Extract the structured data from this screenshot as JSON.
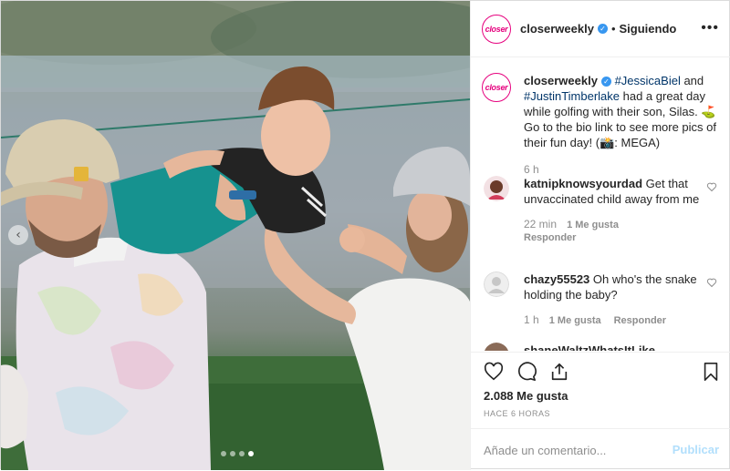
{
  "post": {
    "username": "closerweekly",
    "avatar_text": "closer",
    "verified_mark": "✓",
    "separator": "•",
    "follow_status": "Siguiendo",
    "more_icon": "•••"
  },
  "caption": {
    "username": "closerweekly",
    "tag1": "#JessicaBiel",
    "text1": " and ",
    "tag2": "#JustinTimberlake",
    "text2": " had a great day while golfing with their son, Silas. ⛳ Go to the bio link to see more pics of their fun day! (📸: MEGA)",
    "time": "6 h"
  },
  "comments": [
    {
      "username": "katnipknowsyourdad",
      "text": " Get that unvaccinated child away from me",
      "time": "22 min",
      "likes": "1 Me gusta",
      "reply": "Responder"
    },
    {
      "username": "chazy55523",
      "text": " Oh who's the snake holding the baby?",
      "time": "1 h",
      "likes": "1 Me gusta",
      "reply": "Responder"
    },
    {
      "username": "shaneWaltzWhatsItLike",
      "text": "",
      "time": "",
      "likes": "",
      "reply": ""
    }
  ],
  "actions": {
    "likes": "2.088 Me gusta",
    "ago": "HACE 6 HORAS",
    "comment_placeholder": "Añade un comentario...",
    "publish_label": "Publicar"
  },
  "media": {
    "carousel_arrow": "‹",
    "slide_count": 4,
    "active_slide": 4
  },
  "colors": {
    "link": "#003569",
    "brand": "#e6007e",
    "verified": "#3897f0",
    "publish_disabled": "#b2dffc",
    "muted": "#8e8e8e"
  }
}
